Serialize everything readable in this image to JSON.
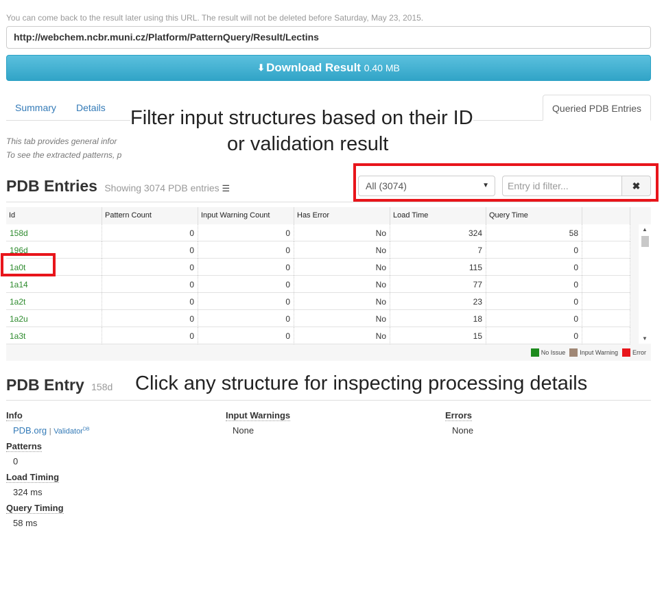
{
  "header": {
    "notice": "You can come back to the result later using this URL. The result will not be deleted before Saturday, May 23, 2015.",
    "url": "http://webchem.ncbr.muni.cz/Platform/PatternQuery/Result/Lectins",
    "download_label": "Download Result",
    "download_size": "0.40 MB"
  },
  "tabs": {
    "summary": "Summary",
    "details": "Details",
    "queried": "Queried PDB Entries"
  },
  "hints": {
    "line1": "This tab provides general infor",
    "line2": "To see the extracted patterns, p"
  },
  "overlays": {
    "filter_line1": "Filter input structures based on their ID",
    "filter_line2": "or validation result",
    "click_hint": "Click any structure for inspecting processing details"
  },
  "entries": {
    "title": "PDB Entries",
    "showing": "Showing 3074 PDB entries",
    "filter_selected": "All (3074)",
    "filter_placeholder": "Entry id filter...",
    "clear_glyph": "✖"
  },
  "grid": {
    "columns": [
      "Id",
      "Pattern Count",
      "Input Warning Count",
      "Has Error",
      "Load Time",
      "Query Time"
    ],
    "rows": [
      [
        "158d",
        "0",
        "0",
        "No",
        "324",
        "58"
      ],
      [
        "196d",
        "0",
        "0",
        "No",
        "7",
        "0"
      ],
      [
        "1a0t",
        "0",
        "0",
        "No",
        "115",
        "0"
      ],
      [
        "1a14",
        "0",
        "0",
        "No",
        "77",
        "0"
      ],
      [
        "1a2t",
        "0",
        "0",
        "No",
        "23",
        "0"
      ],
      [
        "1a2u",
        "0",
        "0",
        "No",
        "18",
        "0"
      ],
      [
        "1a3t",
        "0",
        "0",
        "No",
        "15",
        "0"
      ]
    ],
    "legend": [
      {
        "label": "No Issue",
        "color": "#1e8b1e"
      },
      {
        "label": "Input Warning",
        "color": "#a08775"
      },
      {
        "label": "Error",
        "color": "#e8151b"
      }
    ]
  },
  "entry": {
    "title": "PDB Entry",
    "id": "158d",
    "info_label": "Info",
    "pdb_link": "PDB.org",
    "separator": "|",
    "validator_link": "Validator",
    "validator_sup": "DB",
    "input_warnings_label": "Input Warnings",
    "input_warnings_value": "None",
    "errors_label": "Errors",
    "errors_value": "None",
    "patterns_label": "Patterns",
    "patterns_value": "0",
    "load_timing_label": "Load Timing",
    "load_timing_value": "324 ms",
    "query_timing_label": "Query Timing",
    "query_timing_value": "58 ms"
  },
  "colors": {
    "accent": "#5bc0de",
    "link": "#337ab7",
    "id_green": "#2e8b2e",
    "highlight_red": "#e8151b"
  }
}
